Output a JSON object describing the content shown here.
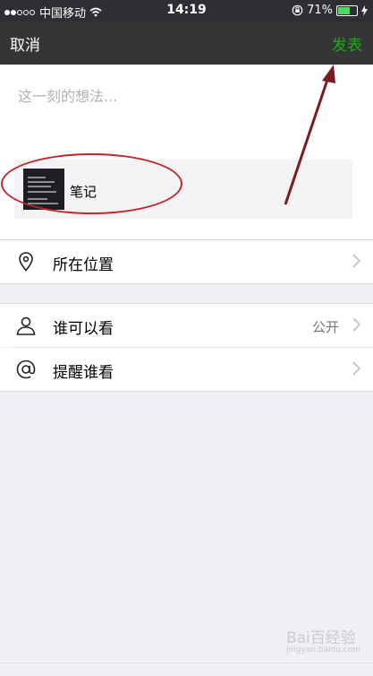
{
  "status_bar": {
    "carrier": "中国移动",
    "time": "14:19",
    "battery_percent": "71%",
    "battery_level": 0.71,
    "icons": [
      "signal-dots-icon",
      "wifi-icon",
      "rotation-lock-icon",
      "battery-icon",
      "charging-bolt-icon"
    ]
  },
  "nav": {
    "cancel_label": "取消",
    "publish_label": "发表",
    "publish_color": "#1aad19"
  },
  "compose": {
    "placeholder": "这一刻的想法...",
    "shared_item": {
      "title": "笔记",
      "thumbnail_icon": "note-thumbnail-image"
    }
  },
  "options": {
    "location": {
      "label": "所在位置",
      "icon": "location-pin-icon"
    },
    "visibility": {
      "label": "谁可以看",
      "value": "公开",
      "icon": "person-icon"
    },
    "mention": {
      "label": "提醒谁看",
      "icon": "at-sign-icon"
    }
  },
  "annotations": {
    "color": "#c0262d",
    "ellipse_target": "shared-item-card",
    "arrow_target": "publish-button"
  },
  "watermark": {
    "text": "Bai百经验",
    "sub": "jingyan.baidu.com"
  }
}
